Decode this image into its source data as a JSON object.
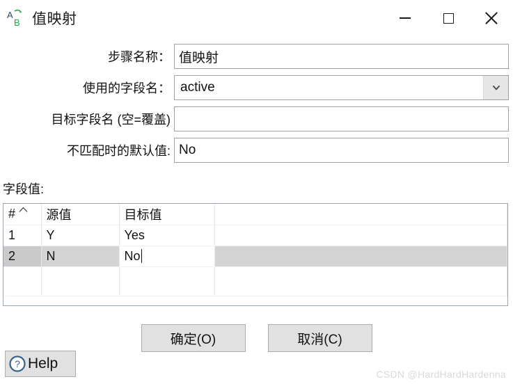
{
  "window": {
    "title": "值映射",
    "icon_name": "value-mapper-icon",
    "controls": {
      "minimize": "minimize-icon",
      "maximize": "maximize-icon",
      "close": "close-icon"
    }
  },
  "form": {
    "rows": [
      {
        "label": "步骤名称：",
        "type": "text",
        "value": "值映射",
        "placeholder": ""
      },
      {
        "label": "使用的字段名：",
        "type": "combo",
        "value": "active",
        "placeholder": "",
        "dropdown_icon": "chevron-down-icon"
      },
      {
        "label": "目标字段名 (空=覆盖)",
        "type": "text",
        "value": "",
        "placeholder": ""
      },
      {
        "label": "不匹配时的默认值:",
        "type": "text",
        "value": "No",
        "placeholder": ""
      }
    ]
  },
  "grid": {
    "caption": "字段值:",
    "sort_icon": "sort-ascending-caret-icon",
    "columns": [
      "#",
      "源值",
      "目标值",
      ""
    ],
    "rows": [
      {
        "num": "1",
        "source": "Y",
        "target": "Yes",
        "selected": false,
        "editing": false
      },
      {
        "num": "2",
        "source": "N",
        "target": "No",
        "selected": true,
        "editing": true
      },
      {
        "num": "",
        "source": "",
        "target": "",
        "selected": false,
        "editing": false
      }
    ]
  },
  "buttons": {
    "ok": "确定(O)",
    "cancel": "取消(C)",
    "help": "Help",
    "help_icon": "question-mark-circle-icon"
  },
  "watermark": "CSDN @HardHardHardenna",
  "colors": {
    "accent_green": "#22a84a",
    "accent_blue": "#2a4a63",
    "help_blue": "#36648b",
    "selection_gray": "#d4d4d4",
    "button_face": "#e1e1e1"
  }
}
